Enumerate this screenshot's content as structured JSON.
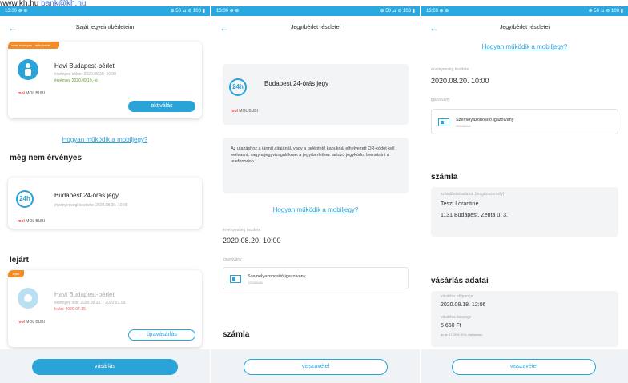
{
  "topline": {
    "site": "www.kh.hu",
    "email": "bank@kh.hu"
  },
  "colors": {
    "accent": "#2aa3d8",
    "status_bar": "#29a9e0",
    "badge": "#f28c28"
  },
  "icons": [
    "back-arrow-icon",
    "person-icon",
    "24h-icon",
    "id-card-icon",
    "mol-bubi-logo-icon"
  ],
  "s1": {
    "status_left": "13:00 ⊕ ⊕",
    "status_right": "⊕ 50 ⊿ ⊜ 100 ▮",
    "title": "Saját jegyeim/bérleteim",
    "active_badge": "most érvényes - aktív bérlet",
    "active_name": "Havi Budapest-bérlet",
    "active_sub": "érvényes ekkor: 2020.08.20. 10:00",
    "active_green": "érvényes 2020.09.19.-ig",
    "activate_btn": "aktiválás",
    "how_link": "Hogyan működik a mobiljegy?",
    "not_valid_title": "még nem érvényes",
    "ticket24_name": "Budapest 24-órás jegy",
    "ticket24_sub": "érvényességi kezdete: 2020.08.20. 10:00",
    "expired_title": "lejárt",
    "expired_badge": "lejárt",
    "expired_name": "Havi Budapest-bérlet",
    "expired_sub": "érvényes volt: 2020.06.20. - 2020.07.19.",
    "expired_red": "lejárt: 2020.07.19.",
    "renew_btn": "újravásárlás",
    "buy_btn": "vásárlás",
    "mol_label": "MOL BUBI"
  },
  "s2": {
    "status_left": "13:00 ⊕ ⊕",
    "status_right": "⊕ 50 ⊿ ⊜ 100 ▮",
    "title": "Jegy/bérlet részletei",
    "ticket_name": "Budapest 24-órás jegy",
    "info_text": "Az utazáshoz a jármű ajtajánál, vagy a beléptető kapuknál elhelyezett QR-kódot kell leolvasni, vagy a jegyvizsgálóknak a jegy/bérlethez tartozó jegykódot bemutatni a telefonodon.",
    "how_link": "Hogyan működik a mobiljegy?",
    "validity_label": "érvényesség kezdete",
    "validity_value": "2020.08.20. 10:00",
    "id_label": "igazolvány",
    "id_name": "Személyazonosító igazolvány",
    "id_num": "123456AB",
    "invoice_title": "számla",
    "back_btn": "visszavétel",
    "mol_label": "MOL BUBI"
  },
  "s3": {
    "status_left": "13:00 ⊕ ⊕",
    "status_right": "⊕ 50 ⊿ ⊜ 100 ▮",
    "title": "Jegy/bérlet részletei",
    "how_link": "Hogyan működik a mobiljegy?",
    "validity_label": "érvényesség kezdete",
    "validity_value": "2020.08.20. 10:00",
    "id_label": "igazolvány",
    "id_name": "Személyazonosító igazolvány",
    "id_num": "123456AB",
    "invoice_title": "számla",
    "invoice_label": "számlázási adatok (magánszemély)",
    "invoice_name": "Teszt Lorantine",
    "invoice_addr": "1131 Budapest, Zenta u. 3.",
    "purchase_title": "vásárlás adatai",
    "purchase_time_label": "vásárlás időpontja",
    "purchase_time": "2020.08.18. 12:06",
    "purchase_amount_label": "vásárlás összege",
    "purchase_amount": "5 650 Ft",
    "purchase_vat": "az ár 27,00% ÁFA-t tartalmaz",
    "back_btn": "visszavétel"
  }
}
